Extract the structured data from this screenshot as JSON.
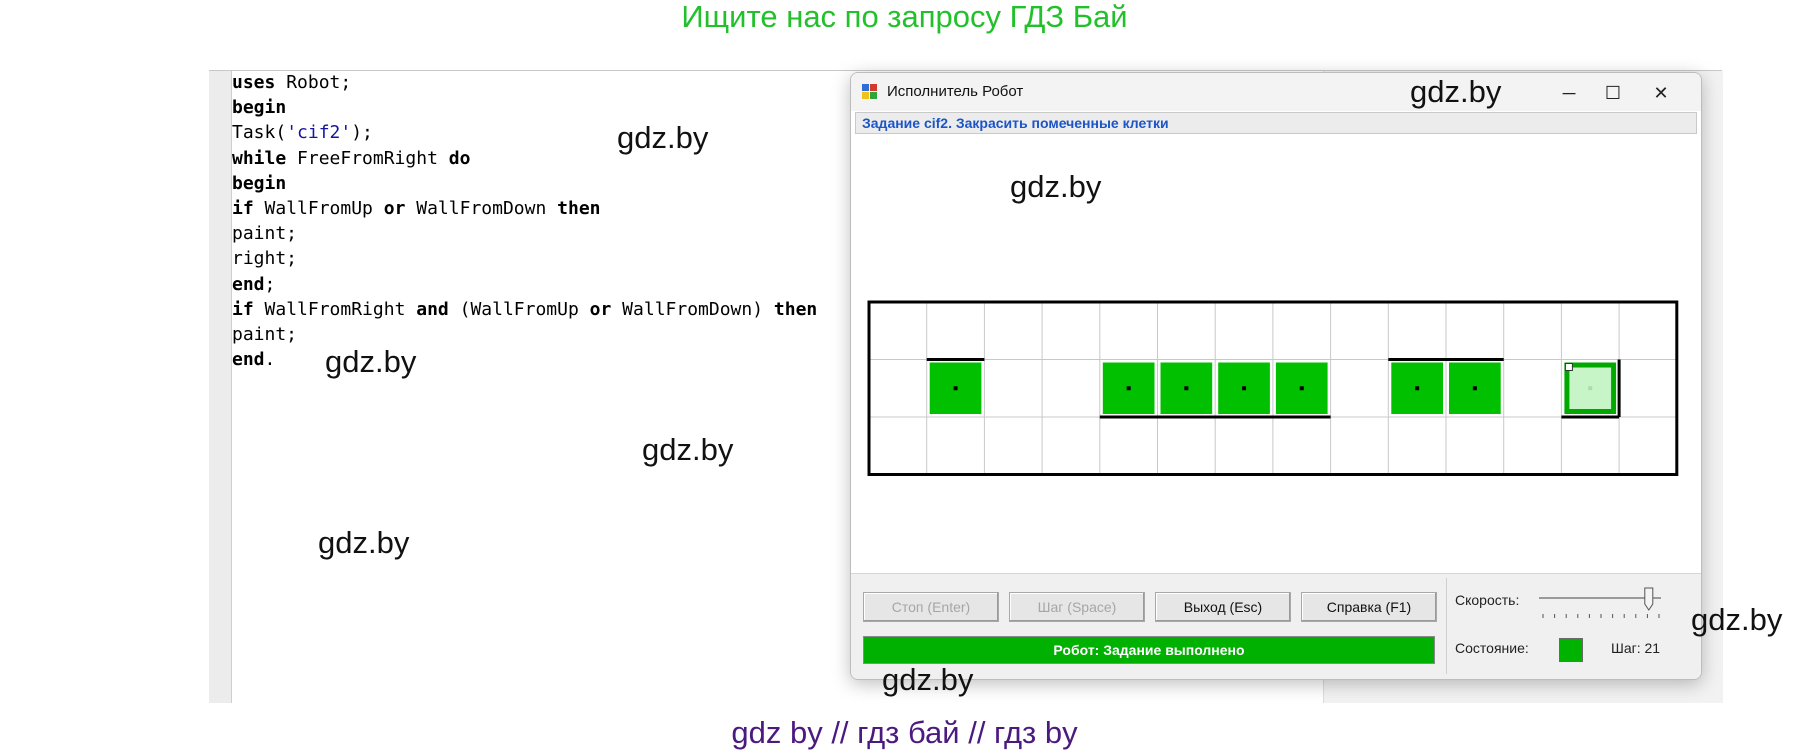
{
  "banner": {
    "top": "Ищите нас по запросу ГДЗ Бай",
    "bottom": "gdz by  //  гдз бай  //  гдз by"
  },
  "watermarks": [
    "gdz.by",
    "gdz.by",
    "gdz.by",
    "gdz.by",
    "gdz.by",
    "gdz.by",
    "gdz.by",
    "gdz.by"
  ],
  "code": {
    "lines": [
      [
        {
          "t": "uses",
          "k": "kw"
        },
        {
          "t": " Robot;"
        }
      ],
      [
        {
          "t": "begin",
          "k": "kw"
        }
      ],
      [
        {
          "t": "Task("
        },
        {
          "t": "'cif2'",
          "k": "str"
        },
        {
          "t": ");"
        }
      ],
      [
        {
          "t": "while",
          "k": "kw"
        },
        {
          "t": " FreeFromRight "
        },
        {
          "t": "do",
          "k": "kw"
        }
      ],
      [
        {
          "t": "begin",
          "k": "kw"
        }
      ],
      [
        {
          "t": "if",
          "k": "kw"
        },
        {
          "t": " WallFromUp "
        },
        {
          "t": "or",
          "k": "kw"
        },
        {
          "t": " WallFromDown "
        },
        {
          "t": "then",
          "k": "kw"
        }
      ],
      [
        {
          "t": "paint;"
        }
      ],
      [
        {
          "t": "right;"
        }
      ],
      [
        {
          "t": "end",
          "k": "kw"
        },
        {
          "t": ";"
        }
      ],
      [
        {
          "t": "if",
          "k": "kw"
        },
        {
          "t": " WallFromRight "
        },
        {
          "t": "and",
          "k": "kw"
        },
        {
          "t": " (WallFromUp "
        },
        {
          "t": "or",
          "k": "kw"
        },
        {
          "t": " WallFromDown) "
        },
        {
          "t": "then",
          "k": "kw"
        }
      ],
      [
        {
          "t": "paint;"
        }
      ],
      [
        {
          "t": "end",
          "k": "kw"
        },
        {
          "t": "."
        }
      ]
    ]
  },
  "robot_window": {
    "title": "Исполнитель Робот",
    "controls": {
      "minimize": "─",
      "maximize": "☐",
      "close": "✕"
    },
    "task": "Задание cif2. Закрасить помеченные клетки",
    "field": {
      "cols": 14,
      "rows": 3,
      "painted_cells": [
        [
          1,
          1
        ],
        [
          4,
          1
        ],
        [
          5,
          1
        ],
        [
          6,
          1
        ],
        [
          7,
          1
        ],
        [
          9,
          1
        ],
        [
          10,
          1
        ]
      ],
      "robot_cell": [
        12,
        1
      ],
      "colors": {
        "painted": "#00c000",
        "robot_fill": "#c8f5c8",
        "robot_border": "#00a800",
        "grid": "#c8c8c8",
        "wall": "#000000"
      }
    },
    "buttons": {
      "stop": "Стоп (Enter)",
      "step": "Шаг (Space)",
      "exit": "Выход (Esc)",
      "help": "Справка (F1)"
    },
    "status": "Робот: Задание выполнено",
    "speed_label": "Скорость:",
    "speed_level": 0.9,
    "state_label": "Состояние:",
    "steps": "Шаг: 21"
  }
}
